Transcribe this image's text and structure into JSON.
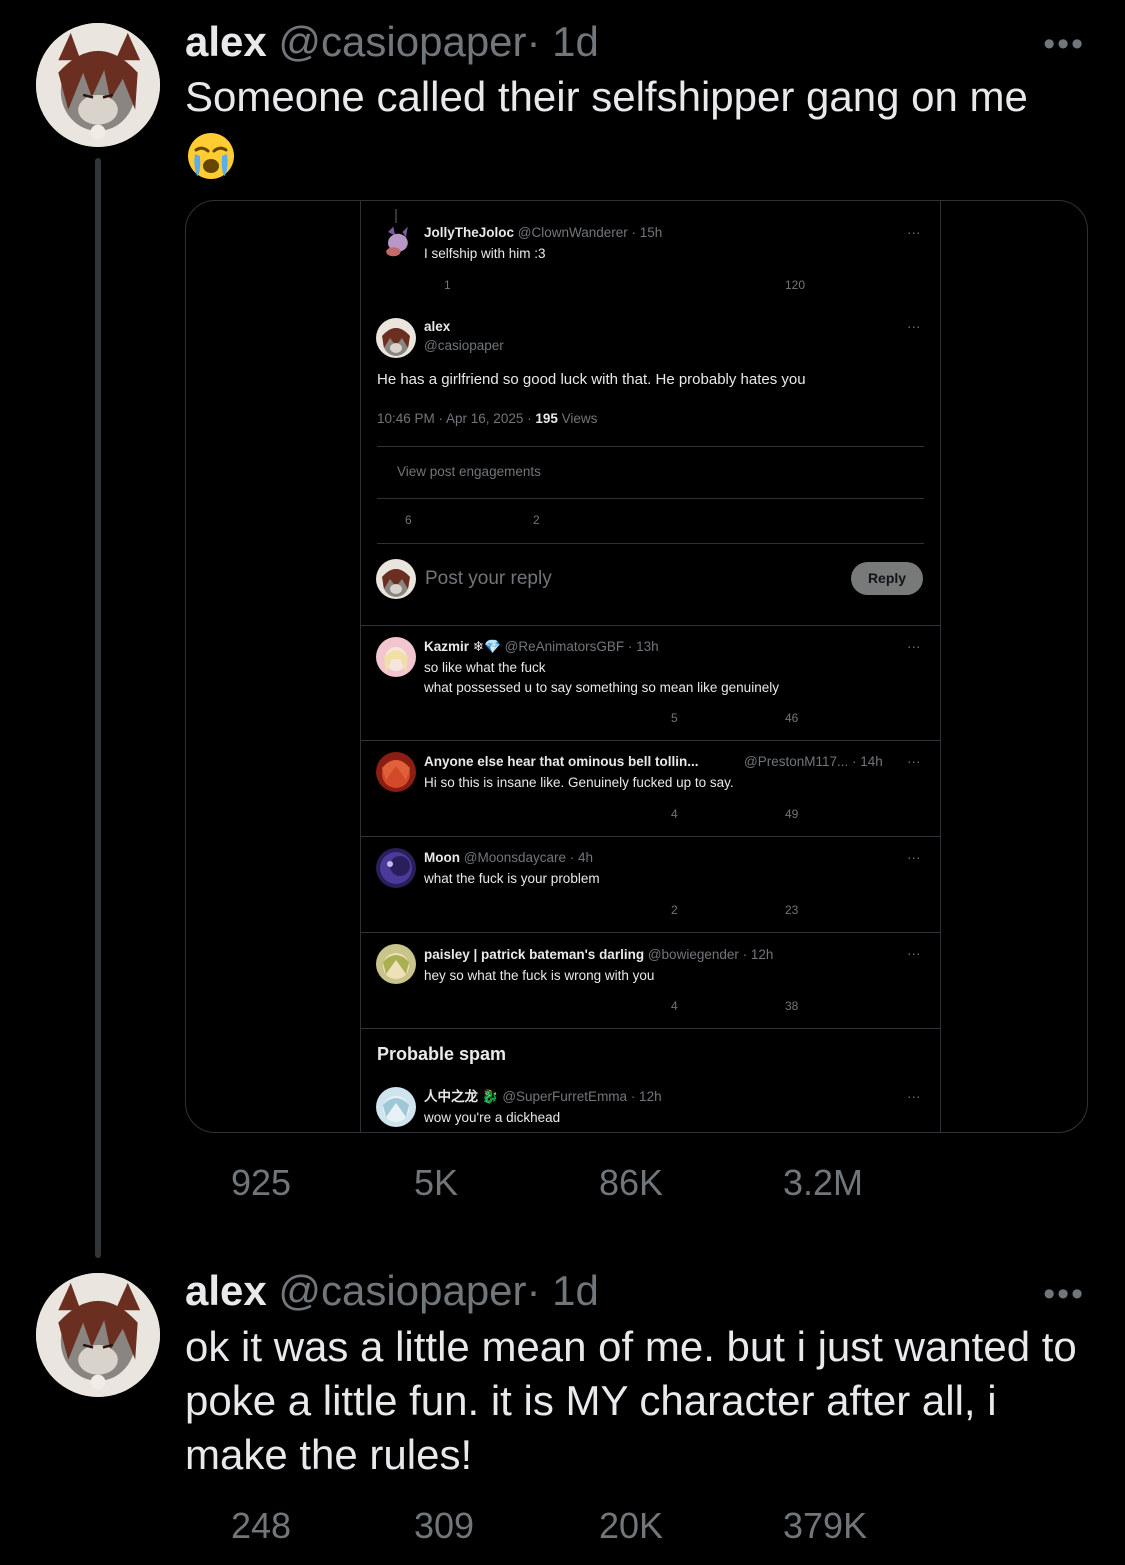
{
  "tweet1": {
    "name": "alex",
    "handle": "@casiopaper",
    "time": "· 1d",
    "text": "Someone called their selfshipper gang on me",
    "emoji": "loudly-crying-face",
    "more": "•••",
    "stats": {
      "replies": "925",
      "reposts": "5K",
      "likes": "86K",
      "views": "3.2M"
    }
  },
  "embed": {
    "parent": {
      "name": "JollyTheJoloc",
      "handle": "@ClownWanderer · 15h",
      "text": "I selfship with him :3",
      "replies": "1",
      "views": "120"
    },
    "main": {
      "name": "alex",
      "handle": "@casiopaper",
      "text": "He has a girlfriend so good luck with that. He probably hates you",
      "timestamp": "10:46 PM · Apr 16, 2025 ·",
      "views_count": "195",
      "views_label": "Views",
      "engagements": "View post engagements",
      "replies": "6",
      "reposts": "2"
    },
    "composer": {
      "placeholder": "Post your reply",
      "button": "Reply"
    },
    "replies": [
      {
        "name": "Kazmir ❄💎",
        "handle": "@ReAnimatorsGBF · 13h",
        "line1": "so like what the fuck",
        "line2": "what possessed u to say something so mean like genuinely",
        "likes": "5",
        "views": "46"
      },
      {
        "name": "Anyone else hear that ominous bell tollin...",
        "handle": "@PrestonM117... · 14h",
        "line1": "Hi so this is insane like. Genuinely fucked up to say.",
        "line2": "",
        "likes": "4",
        "views": "49"
      },
      {
        "name": "Moon",
        "handle": "@Moonsdaycare · 4h",
        "line1": "what the fuck is your problem",
        "line2": "",
        "likes": "2",
        "views": "23"
      },
      {
        "name": "paisley | patrick bateman's darling",
        "handle": "@bowiegender · 12h",
        "line1": "hey so what the fuck is wrong with you",
        "line2": "",
        "likes": "4",
        "views": "38"
      }
    ],
    "spam_header": "Probable spam",
    "spam": {
      "name": "人中之龙 🐉",
      "handle": "@SuperFurretEmma · 12h",
      "text": "wow you're a dickhead"
    }
  },
  "tweet2": {
    "name": "alex",
    "handle": "@casiopaper",
    "time": "· 1d",
    "text": "ok it was a little mean of me. but i just wanted to poke a little fun. it is MY character after all, i make the rules!",
    "more": "•••",
    "stats": {
      "replies": "248",
      "reposts": "309",
      "likes": "20K",
      "views": "379K"
    }
  },
  "colors": {
    "background": "#000000",
    "text": "#e7e9ea",
    "secondary": "#71767b",
    "border": "#2f3336"
  }
}
